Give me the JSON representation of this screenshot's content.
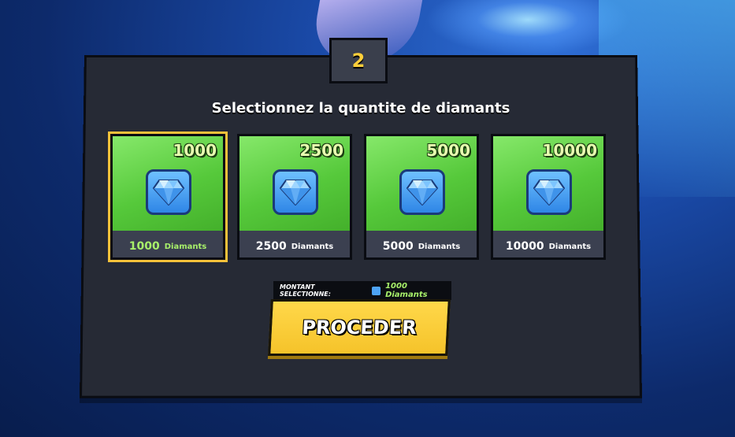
{
  "step": {
    "number": "2"
  },
  "title": "Selectionnez la quantite de diamants",
  "packs": [
    {
      "amount": "1000",
      "label_num": "1000",
      "label_unit": "Diamants",
      "selected": true
    },
    {
      "amount": "2500",
      "label_num": "2500",
      "label_unit": "Diamants",
      "selected": false
    },
    {
      "amount": "5000",
      "label_num": "5000",
      "label_unit": "Diamants",
      "selected": false
    },
    {
      "amount": "10000",
      "label_num": "10000",
      "label_unit": "Diamants",
      "selected": false
    }
  ],
  "selection": {
    "label": "MONTANT SELECTIONNE:",
    "value": "1000 Diamants"
  },
  "proceed_label": "PROCEDER",
  "colors": {
    "accent_yellow": "#f5c32a",
    "green_card": "#56c93b",
    "selected_text": "#a8f06a",
    "panel": "#262a35"
  }
}
